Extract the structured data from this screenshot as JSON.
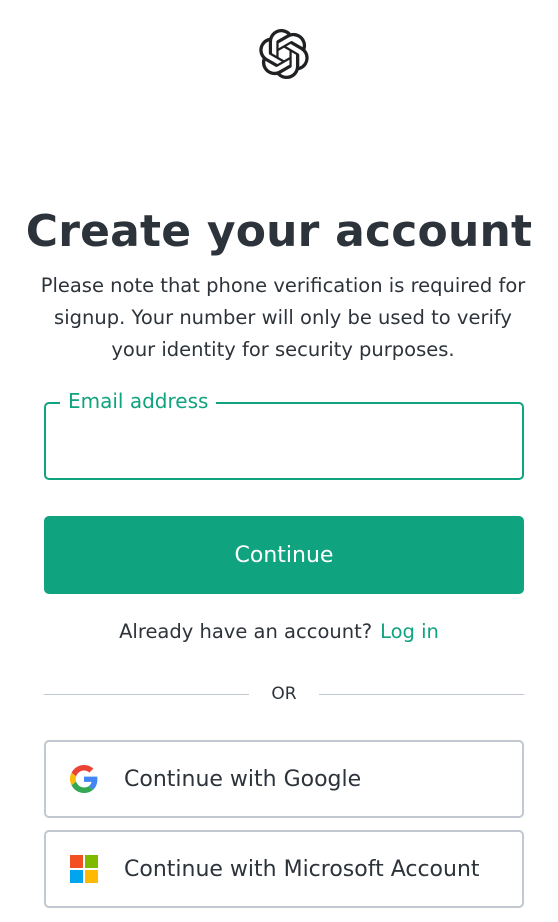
{
  "logo": {
    "icon": "openai-logo-icon"
  },
  "heading": {
    "title": "Create your account"
  },
  "notice": {
    "text": "Please note that phone verification is required for signup. Your number will only be used to verify your identity for security purposes."
  },
  "email": {
    "label": "Email address",
    "value": "",
    "accent_color": "#10a37f"
  },
  "continue_button": {
    "label": "Continue",
    "color": "#10a37f"
  },
  "login_prompt": {
    "text": "Already have an account?",
    "link": "Log in"
  },
  "divider": {
    "text": "OR"
  },
  "social": {
    "google": {
      "label": "Continue with Google",
      "icon": "google-icon"
    },
    "microsoft": {
      "label": "Continue with Microsoft Account",
      "icon": "microsoft-icon"
    }
  }
}
